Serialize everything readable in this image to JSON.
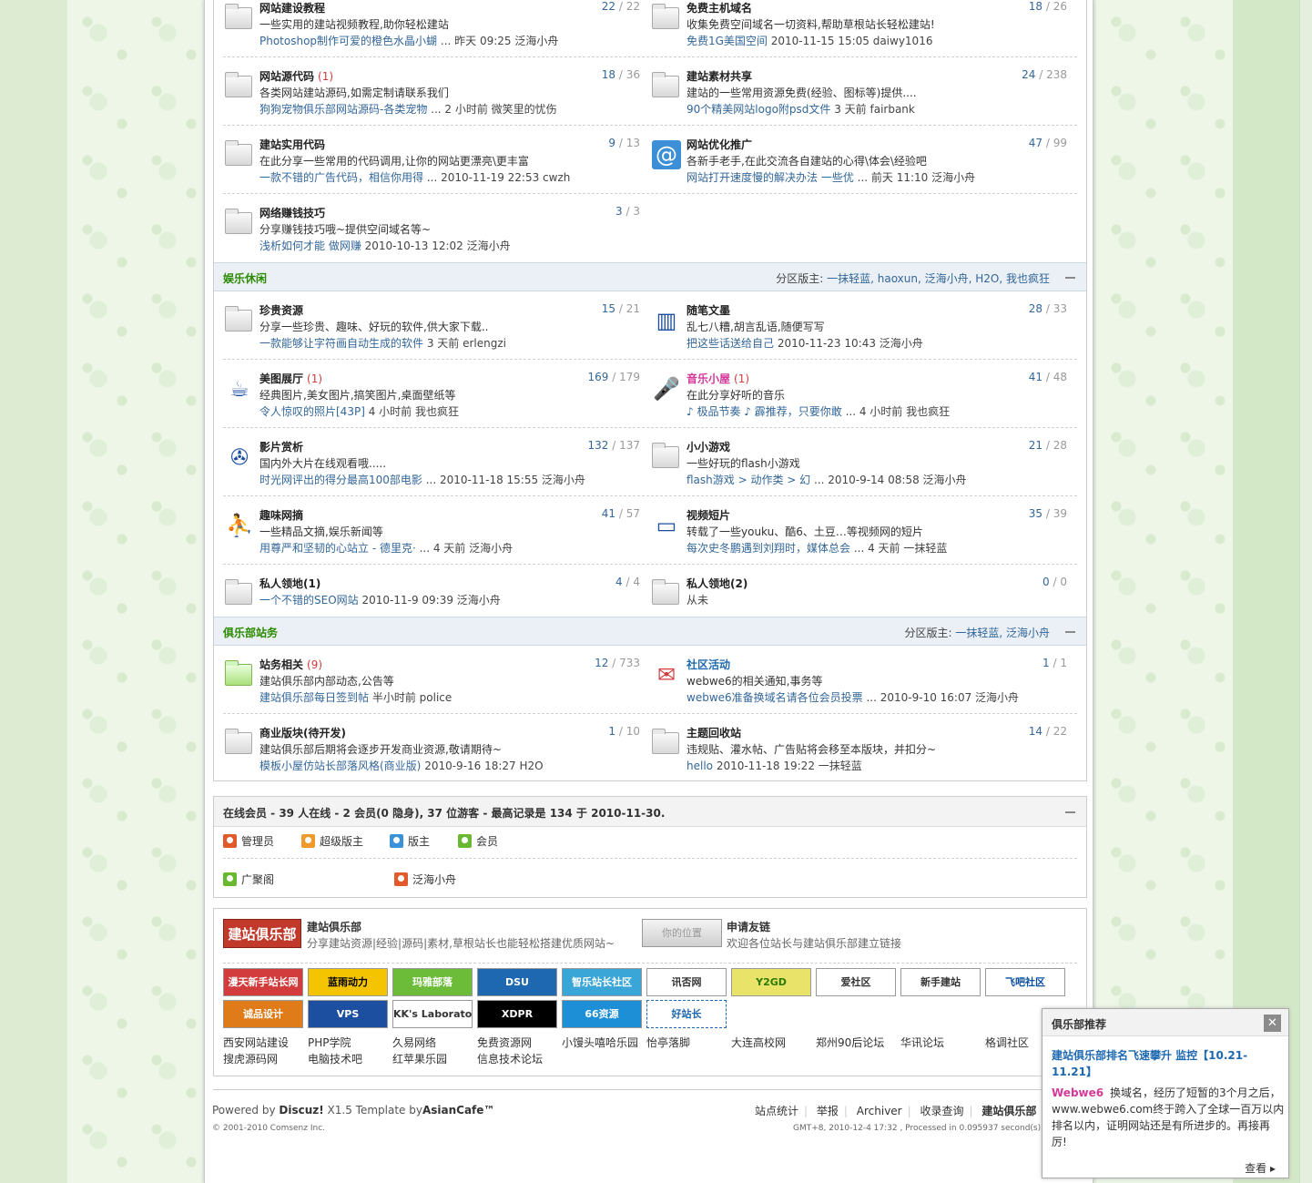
{
  "forums_top": [
    {
      "name": "网站建设教程",
      "new": "",
      "today": "22",
      "total": "22",
      "desc": "一些实用的建站视频教程,助你轻松建站",
      "last_link": "Photoshop制作可爱的橙色水晶小蝴",
      "last_meta": " ... 昨天 09:25 泛海小舟",
      "icon": "folder"
    },
    {
      "name": "免费主机域名",
      "new": "",
      "today": "18",
      "total": "26",
      "desc": "收集免费空间域名一切资料,帮助草根站长轻松建站!",
      "last_link": "免费1G美国空间",
      "last_meta": "  2010-11-15 15:05 daiwy1016",
      "icon": "folder"
    },
    {
      "name": "网站源代码",
      "new": "(1)",
      "today": "18",
      "total": "36",
      "desc": "各类网站建站源码,如需定制请联系我们",
      "last_link": "狗狗宠物俱乐部网站源码-各类宠物",
      "last_meta": " ... 2 小时前  微笑里的忧伤",
      "icon": "folder"
    },
    {
      "name": "建站素材共享",
      "new": "",
      "today": "24",
      "total": "238",
      "desc": "建站的一些常用资源免费(经验、图标等)提供....",
      "last_link": "90个精美网站logo附psd文件",
      "last_meta": "  3 天前  fairbank",
      "icon": "folder"
    },
    {
      "name": "建站实用代码",
      "new": "",
      "today": "9",
      "total": "13",
      "desc": "在此分享一些常用的代码调用,让你的网站更漂亮\\更丰富",
      "last_link": "一款不错的广告代码，相信你用得",
      "last_meta": " ... 2010-11-19 22:53 cwzh",
      "icon": "folder"
    },
    {
      "name": "网站优化推广",
      "new": "",
      "today": "47",
      "total": "99",
      "desc": "各新手老手,在此交流各自建站的心得\\体会\\经验吧",
      "last_link": "网站打开速度慢的解决办法 一些优",
      "last_meta": " ... 前天 11:10 泛海小舟",
      "icon": "notebook"
    },
    {
      "name": "网络赚钱技巧",
      "new": "",
      "today": "3",
      "total": "3",
      "desc": "分享赚钱技巧哦~提供空间域名等~",
      "last_link": "浅析如何才能 做网赚",
      "last_meta": "  2010-10-13 12:02 泛海小舟",
      "icon": "folder"
    }
  ],
  "group_ent": {
    "name": "娱乐休闲",
    "mods_label": "分区版主: ",
    "mods": "一抹轻蓝, haoxun, 泛海小舟, H2O, 我也疯狂"
  },
  "forums_ent": [
    {
      "name": "珍贵资源",
      "new": "",
      "today": "15",
      "total": "21",
      "desc": "分享一些珍贵、趣味、好玩的软件,供大家下载..",
      "last_link": "一款能够让字符画自动生成的软件",
      "last_meta": "  3 天前  erlengzi",
      "icon": "folder"
    },
    {
      "name": "随笔文墨",
      "new": "",
      "today": "28",
      "total": "33",
      "desc": "乱七八糟,胡言乱语,随便写写",
      "last_link": "把这些话送给自己",
      "last_meta": "  2010-11-23 10:43 泛海小舟",
      "icon": "books"
    },
    {
      "name": "美图展厅",
      "new": "(1)",
      "today": "169",
      "total": "179",
      "desc": "经典图片,美女图片,搞笑图片,桌面壁纸等",
      "last_link": "令人惊叹的照片[43P]",
      "last_meta": " 4 小时前  我也疯狂",
      "icon": "cup"
    },
    {
      "name": "音乐小屋",
      "new": "(1)",
      "today": "41",
      "total": "48",
      "desc": "在此分享好听的音乐",
      "last_link": "♪ 极品节奏 ♪ 霹推荐，只要你敢",
      "last_meta": " ... 4 小时前  我也疯狂",
      "icon": "mic",
      "pink": true
    },
    {
      "name": "影片赏析",
      "new": "",
      "today": "132",
      "total": "137",
      "desc": "国内外大片在线观看哦.....",
      "last_link": "时光网评出的得分最高100部电影",
      "last_meta": " ... 2010-11-18 15:55 泛海小舟",
      "icon": "film"
    },
    {
      "name": "小小游戏",
      "new": "",
      "today": "21",
      "total": "28",
      "desc": "一些好玩的flash小游戏",
      "last_link": "flash游戏 > 动作类 > 幻",
      "last_meta": " ... 2010-9-14 08:58 泛海小舟",
      "icon": "folder"
    },
    {
      "name": "趣味网摘",
      "new": "",
      "today": "41",
      "total": "57",
      "desc": "一些精品文摘,娱乐新闻等",
      "last_link": "用尊严和坚韧的心站立 - 德里克·",
      "last_meta": " ... 4 天前  泛海小舟",
      "icon": "person"
    },
    {
      "name": "视频短片",
      "new": "",
      "today": "35",
      "total": "39",
      "desc": "转载了一些youku、酷6、土豆…等视频网的短片",
      "last_link": "每次史冬鹏遇到刘翔时，媒体总会",
      "last_meta": " ... 4 天前  一抹轻蓝",
      "icon": "monitor"
    },
    {
      "name": "私人领地(1)",
      "new": "",
      "today": "4",
      "total": "4",
      "desc": "",
      "last_link": "一个不错的SEO网站",
      "last_meta": "  2010-11-9 09:39 泛海小舟",
      "icon": "folder",
      "short": true
    },
    {
      "name": "私人领地(2)",
      "new": "",
      "today": "0",
      "total": "0",
      "desc": "",
      "last_link": "",
      "last_meta": "从未",
      "icon": "folder",
      "short": true
    }
  ],
  "group_club": {
    "name": "俱乐部站务",
    "mods_label": "分区版主: ",
    "mods": "一抹轻蓝, 泛海小舟"
  },
  "forums_club": [
    {
      "name": "站务相关",
      "new": "(9)",
      "today": "12",
      "total": "733",
      "desc": "建站俱乐部内部动态,公告等",
      "last_link": "建站俱乐部每日签到帖",
      "last_meta": "  半小时前  police",
      "icon": "folder-g"
    },
    {
      "name": "社区活动",
      "new": "",
      "today": "1",
      "total": "1",
      "desc": "webwe6的相关通知,事务等",
      "last_link": "webwe6准备换域名请各位会员投票",
      "last_meta": " ... 2010-9-10 16:07 泛海小舟",
      "icon": "gift",
      "blue": true
    },
    {
      "name": "商业版块(待开发)",
      "new": "",
      "today": "1",
      "total": "10",
      "desc": "建站俱乐部后期将会逐步开发商业资源,敬请期待~",
      "last_link": "模板小屋仿站长部落风格(商业版)",
      "last_meta": " 2010-9-16 18:27 H2O",
      "icon": "folder"
    },
    {
      "name": "主题回收站",
      "new": "",
      "today": "14",
      "total": "22",
      "desc": "违规贴、灌水帖、广告贴将会移至本版块，并扣分~",
      "last_link": "hello",
      "last_meta": " 2010-11-18 19:22 一抹轻蓝",
      "icon": "folder"
    }
  ],
  "online": {
    "title": "在线会员 - 39 人在线 - 2 会员(0 隐身), 37 位游客 - 最高记录是  134 于  2010-11-30.",
    "legend": [
      "管理员",
      "超级版主",
      "版主",
      "会员"
    ],
    "users": [
      "广聚阁",
      "泛海小舟"
    ]
  },
  "links": {
    "club_name": "建站俱乐部",
    "club_desc": "分享建站资源|经验|源码|素材,草根站长也能轻松搭建优质网站~",
    "club_logo": "建站俱乐部",
    "apply_name": "申请友链",
    "apply_desc": "欢迎各位站长与建站俱乐部建立链接",
    "apply_logo": "你的位置",
    "badges": [
      "漫天新手站长网",
      "蓝雨动力",
      "玛雅部落",
      "DSU",
      "智乐站长社区",
      "讯否网",
      "Y2GD",
      "爱社区",
      "新手建站",
      "飞吧社区",
      "诚品设计",
      "VPS",
      "KK's Laboratory",
      "XDPR",
      "66资源",
      "好站长"
    ],
    "texts": [
      "西安网站建设",
      "PHP学院",
      "久易网络",
      "免费资源网",
      "小馒头嘻哈乐园",
      "怡亭落脚",
      "大连高校网",
      "郑州90后论坛",
      "华讯论坛",
      "格调社区",
      "搜虎源码网",
      "电脑技术吧",
      "红苹果乐园",
      "信息技术论坛"
    ]
  },
  "footer": {
    "powered": "Powered by ",
    "discuz": "Discuz!",
    "ver": " X1.5 Template by",
    "asian": "AsianCafe™",
    "copy": "© 2001-2010 Comsenz Inc.",
    "links": [
      "站点统计",
      "举报",
      "Archiver",
      "收录查询",
      "建站俱乐部"
    ],
    "gmt": "GMT+8, 2010-12-4 17:32 , Processed in 0.095937 second(s), 1"
  },
  "popup": {
    "title": "俱乐部推荐",
    "close": "✕",
    "headline": "建站俱乐部排名飞速攀升 监控【10.21-11.21】",
    "logo": "Webwe6",
    "body": "换域名，经历了短暂的3个月之后，www.webwe6.com终于跨入了全球一百万以内排名以内，证明网站还是有所进步的。再接再厉!",
    "more": "查看 ▸"
  },
  "colors": {
    "accent": "#336699",
    "group": "#2b8a00",
    "new": "#d23c3c"
  }
}
